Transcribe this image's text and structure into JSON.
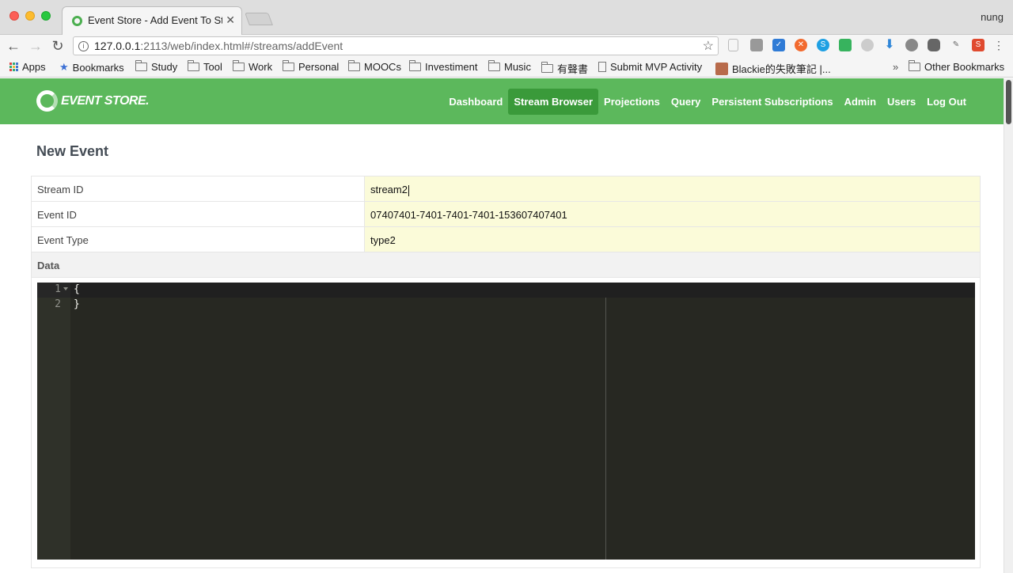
{
  "browser": {
    "tab_title": "Event Store - Add Event To Str",
    "profile": "nung",
    "url_host": "127.0.0.1",
    "url_rest": ":2113/web/index.html#/streams/addEvent",
    "bookmarks": [
      {
        "label": "Apps",
        "icon": "apps-icon"
      },
      {
        "label": "Bookmarks",
        "icon": "star-icon"
      },
      {
        "label": "Study",
        "icon": "folder-icon"
      },
      {
        "label": "Tool",
        "icon": "folder-icon"
      },
      {
        "label": "Work",
        "icon": "folder-icon"
      },
      {
        "label": "Personal",
        "icon": "folder-icon"
      },
      {
        "label": "MOOCs",
        "icon": "folder-icon"
      },
      {
        "label": "Investiment",
        "icon": "folder-icon"
      },
      {
        "label": "Music",
        "icon": "folder-icon"
      },
      {
        "label": "有聲書",
        "icon": "folder-icon"
      },
      {
        "label": "Submit MVP Activity",
        "icon": "page-icon"
      },
      {
        "label": "Blackie的失敗筆記 |...",
        "icon": "avatar-icon"
      }
    ],
    "bookmarks_overflow": "»",
    "other_bookmarks": "Other Bookmarks"
  },
  "app": {
    "logo_text": "EVENT STORE.",
    "nav": [
      {
        "label": "Dashboard",
        "active": false
      },
      {
        "label": "Stream Browser",
        "active": true
      },
      {
        "label": "Projections",
        "active": false
      },
      {
        "label": "Query",
        "active": false
      },
      {
        "label": "Persistent Subscriptions",
        "active": false
      },
      {
        "label": "Admin",
        "active": false
      },
      {
        "label": "Users",
        "active": false
      },
      {
        "label": "Log Out",
        "active": false
      }
    ],
    "page_title": "New Event",
    "form": {
      "stream_id_label": "Stream ID",
      "stream_id_value": "stream2",
      "event_id_label": "Event ID",
      "event_id_value": "07407401-7401-7401-7401-153607407401",
      "event_type_label": "Event Type",
      "event_type_value": "type2",
      "data_label": "Data"
    },
    "editor": {
      "line_numbers": [
        "1",
        "2"
      ],
      "lines": [
        "{",
        "}"
      ]
    },
    "colors": {
      "navbar": "#5cb85c",
      "nav_active": "#3a9a3a",
      "input_bg": "#fbfbd9",
      "editor_bg": "#272822"
    }
  }
}
